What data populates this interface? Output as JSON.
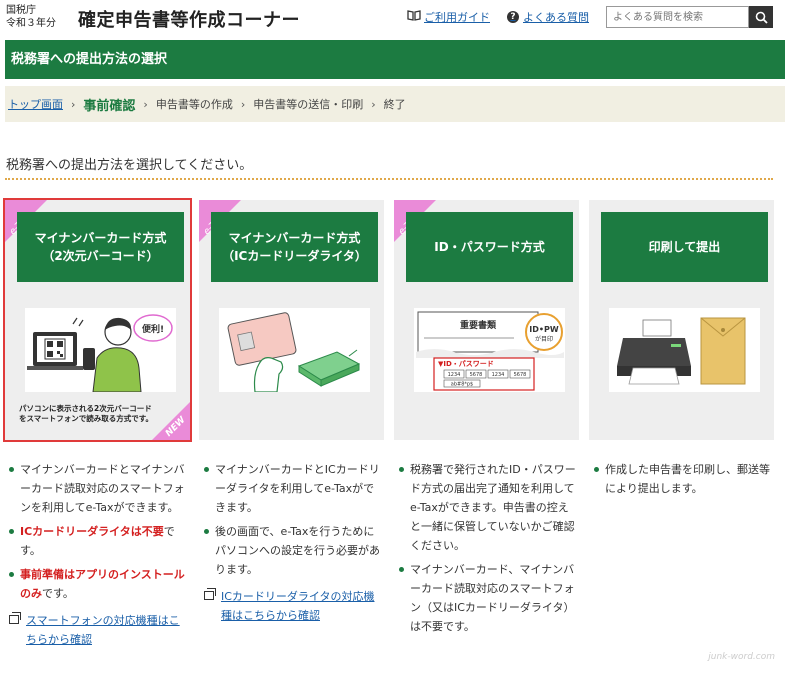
{
  "header": {
    "agency_line1": "国税庁",
    "agency_line2": "令和３年分",
    "title": "確定申告書等作成コーナー",
    "guide_link": "ご利用ガイド",
    "faq_link": "よくある質問",
    "search_placeholder": "よくある質問を検索"
  },
  "section_title": "税務署への提出方法の選択",
  "breadcrumb": {
    "top": "トップ画面",
    "current": "事前確認",
    "step3": "申告書等の作成",
    "step4": "申告書等の送信・印刷",
    "step5": "終了"
  },
  "instruction": "税務署への提出方法を選択してください。",
  "cards": [
    {
      "ribbon": "e-Tax",
      "line1": "マイナンバーカード方式",
      "line2": "（2次元バーコード）",
      "bubble": "便利!",
      "caption1": "パソコンに表示される2次元バーコード",
      "caption2": "をスマートフォンで読み取る方式です。",
      "new_tag": "NEW",
      "selected": true
    },
    {
      "ribbon": "e-Tax",
      "line1": "マイナンバーカード方式",
      "line2": "（ICカードリーダライタ）"
    },
    {
      "ribbon": "e-Tax",
      "line1": "ID・パスワード方式",
      "doc_title": "重要書類",
      "badge": "ID•PW",
      "badge_sub": "が目印",
      "id_label": "▼ID・パスワード",
      "id_cells": [
        "1234",
        "5678",
        "1234",
        "5678"
      ],
      "pw_value": "ab#8*p$"
    },
    {
      "line1": "印刷して提出"
    }
  ],
  "col1": {
    "p1": "マイナンバーカードとマイナンバーカード読取対応のスマートフォンを利用してe-Taxができます。",
    "p2a": "ICカードリーダライタは不要",
    "p2b": "です。",
    "p3a": "事前準備はアプリのインストールのみ",
    "p3b": "です。",
    "link": "スマートフォンの対応機種はこちらから確認"
  },
  "col2": {
    "p1": "マイナンバーカードとICカードリーダライタを利用してe-Taxができます。",
    "p2": "後の画面で、e-Taxを行うためにパソコンへの設定を行う必要があります。",
    "link": "ICカードリーダライタの対応機種はこちらから確認"
  },
  "col3": {
    "p1": "税務署で発行されたID・パスワード方式の届出完了通知を利用してe-Taxができます。申告書の控えと一緒に保管していないかご確認ください。",
    "p2": "マイナンバーカード、マイナンバーカード読取対応のスマートフォン（又はICカードリーダライタ）は不要です。"
  },
  "col4": {
    "p1": "作成した申告書を印刷し、郵送等により提出します。"
  },
  "watermark": "junk-word.com",
  "colors": {
    "green": "#1c7b41",
    "pink": "#ea8bd8",
    "red": "#d42020",
    "link": "#1a5fa8",
    "selection": "#e03a3a"
  }
}
